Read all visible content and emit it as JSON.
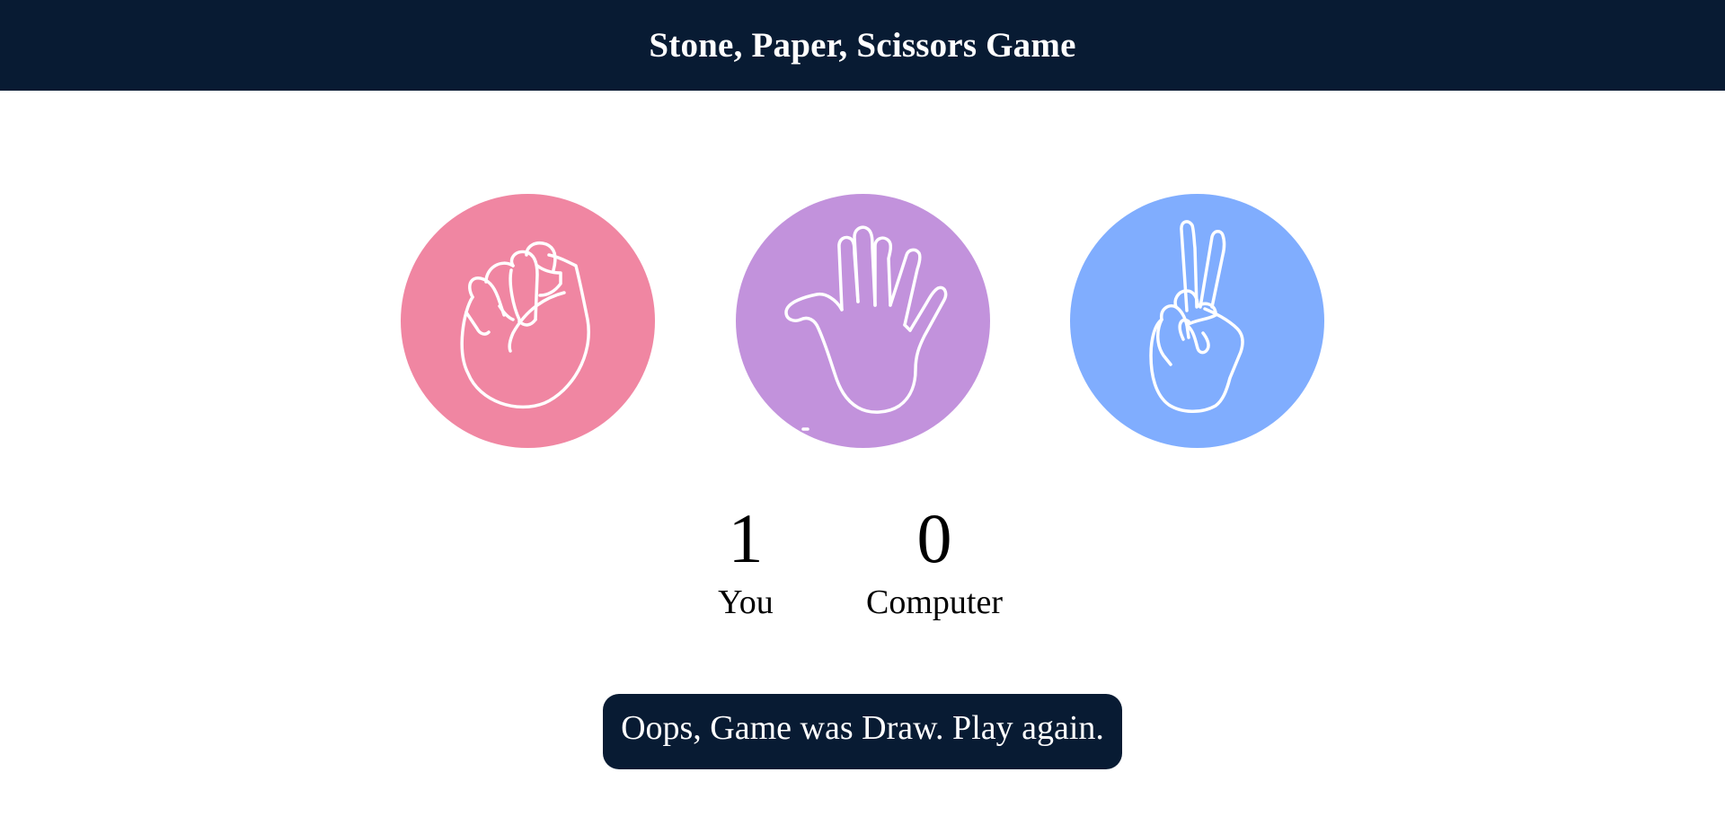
{
  "header": {
    "title": "Stone, Paper, Scissors Game"
  },
  "choices": [
    {
      "id": "rock",
      "icon": "fist-icon",
      "color": "#f086a2"
    },
    {
      "id": "paper",
      "icon": "open-hand-icon",
      "color": "#c292dc"
    },
    {
      "id": "scissors",
      "icon": "peace-hand-icon",
      "color": "#80adfe"
    }
  ],
  "scores": {
    "user": {
      "value": "1",
      "label": "You"
    },
    "computer": {
      "value": "0",
      "label": "Computer"
    }
  },
  "message": {
    "text": "Oops, Game was Draw. Play again.",
    "bg_color": "#081b33"
  },
  "colors": {
    "header_bg": "#081b33",
    "text_light": "#ffffff",
    "text_dark": "#000000"
  }
}
